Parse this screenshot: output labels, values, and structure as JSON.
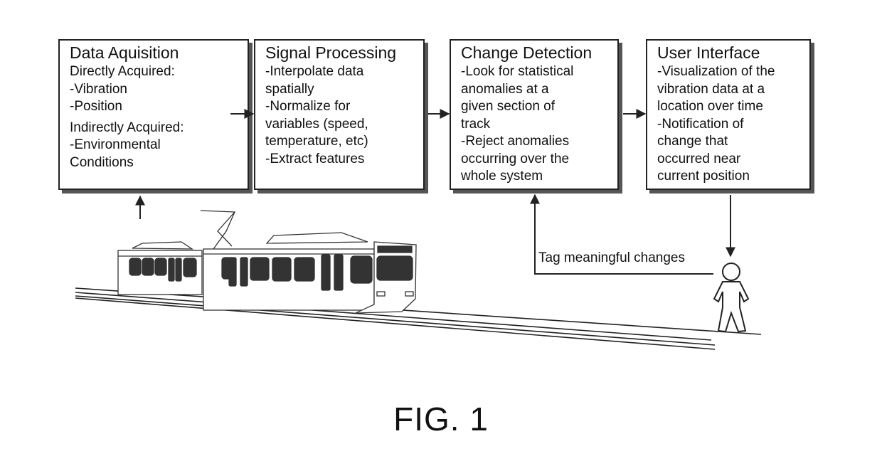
{
  "diagram": {
    "boxes": [
      {
        "title": "Data Aquisition",
        "lines": [
          "Directly Acquired:",
          "-Vibration",
          "-Position",
          "",
          "Indirectly Acquired:",
          "-Environmental",
          "Conditions"
        ]
      },
      {
        "title": "Signal Processing",
        "lines": [
          "-Interpolate data",
          "spatially",
          "-Normalize for",
          "variables (speed,",
          "temperature, etc)",
          "-Extract features"
        ]
      },
      {
        "title": "Change Detection",
        "lines": [
          "-Look for statistical",
          "anomalies at a",
          "given section of",
          "track",
          "-Reject anomalies",
          "occurring over the",
          "whole system"
        ]
      },
      {
        "title": "User Interface",
        "lines": [
          "-Visualization of the",
          "vibration data at a",
          "location over time",
          "-Notification of",
          "change that",
          "occurred near",
          "current position"
        ]
      }
    ],
    "feedback_label": "Tag meaningful changes",
    "figure_label": "FIG. 1",
    "illustrations": [
      "train-illustration",
      "person-icon",
      "railway-track"
    ]
  }
}
